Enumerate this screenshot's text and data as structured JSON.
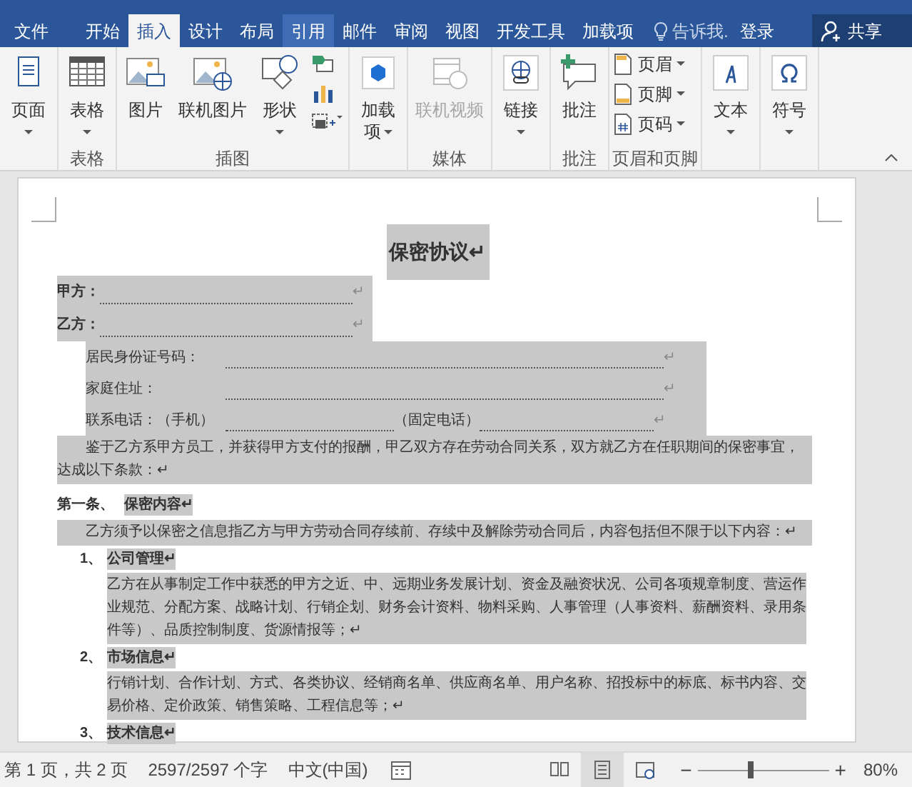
{
  "menu_tabs": [
    {
      "label": "文件",
      "selected": false,
      "hover": false
    },
    {
      "label": "开始",
      "selected": false,
      "hover": false
    },
    {
      "label": "插入",
      "selected": true,
      "hover": false
    },
    {
      "label": "设计",
      "selected": false,
      "hover": false
    },
    {
      "label": "布局",
      "selected": false,
      "hover": false
    },
    {
      "label": "引用",
      "selected": false,
      "hover": true
    },
    {
      "label": "邮件",
      "selected": false,
      "hover": false
    },
    {
      "label": "审阅",
      "selected": false,
      "hover": false
    },
    {
      "label": "视图",
      "selected": false,
      "hover": false
    },
    {
      "label": "开发工具",
      "selected": false,
      "hover": false
    },
    {
      "label": "加载项",
      "selected": false,
      "hover": false
    }
  ],
  "tell_me": "告诉我.",
  "login": "登录",
  "share": "共享",
  "ribbon_groups": [
    {
      "buttons": [
        {
          "kind": "large",
          "label": "页面",
          "dropdown": true,
          "disabled": false
        }
      ]
    },
    {
      "label": "表格",
      "buttons": [
        {
          "kind": "large",
          "label": "表格",
          "dropdown": true,
          "disabled": false
        }
      ]
    },
    {
      "label": "插图",
      "buttons": [
        {
          "kind": "large",
          "label": "图片",
          "dropdown": false,
          "disabled": false
        },
        {
          "kind": "large",
          "label": "联机图片",
          "dropdown": false,
          "disabled": false
        },
        {
          "kind": "large",
          "label": "形状",
          "dropdown": true,
          "disabled": false
        },
        {
          "kind": "icons"
        }
      ]
    },
    {
      "buttons": [
        {
          "kind": "large",
          "label": "加载",
          "label2": "项",
          "dropdown": true,
          "disabled": false
        }
      ]
    },
    {
      "label": "媒体",
      "buttons": [
        {
          "kind": "large",
          "label": "联机视频",
          "dropdown": false,
          "disabled": true
        }
      ]
    },
    {
      "buttons": [
        {
          "kind": "large",
          "label": "链接",
          "dropdown": true,
          "disabled": false
        }
      ]
    },
    {
      "label": "批注",
      "buttons": [
        {
          "kind": "large",
          "label": "批注",
          "dropdown": false,
          "disabled": false
        }
      ]
    },
    {
      "label": "页眉和页脚",
      "buttons": [
        {
          "kind": "small",
          "label": "页眉",
          "dropdown": true,
          "disabled": false
        },
        {
          "kind": "small",
          "label": "页脚",
          "dropdown": true,
          "disabled": false
        },
        {
          "kind": "small",
          "label": "页码",
          "dropdown": true,
          "disabled": false
        }
      ]
    },
    {
      "buttons": [
        {
          "kind": "large",
          "label": "文本",
          "dropdown": true,
          "disabled": false
        }
      ]
    },
    {
      "buttons": [
        {
          "kind": "large",
          "label": "符号",
          "dropdown": true,
          "disabled": false
        }
      ]
    }
  ],
  "document": [
    {
      "kind": "title",
      "text": "保密协议↵",
      "highlighted": true
    },
    {
      "kind": "party",
      "label": "甲方：",
      "end": "↵",
      "highlighted": true
    },
    {
      "kind": "party",
      "label": "乙方：",
      "end": "↵",
      "highlighted": true
    },
    {
      "kind": "field",
      "label": "居民身份证号码：",
      "end": "↵",
      "highlighted": true
    },
    {
      "kind": "field",
      "label": "家庭住址：",
      "end": "↵",
      "highlighted": true
    },
    {
      "kind": "phone",
      "label": "联系电话：（手机）",
      "label2": "（固定电话）",
      "end": "↵",
      "highlighted": true
    },
    {
      "kind": "body",
      "text": "鉴于乙方系甲方员工，并获得甲方支付的报酬，甲乙双方存在劳动合同关系，双方就乙方在任职期间的保密事宜，达成以下条款：↵",
      "highlighted": true
    },
    {
      "kind": "article",
      "number": "第一条、",
      "text": "保密内容↵",
      "highlighted": true
    },
    {
      "kind": "body",
      "text": "乙方须予以保密之信息指乙方与甲方劳动合同存续前、存续中及解除劳动合同后，内容包括但不限于以下内容：↵",
      "highlighted": true
    },
    {
      "kind": "item",
      "number": "1、",
      "text": "公司管理↵",
      "highlighted": true
    },
    {
      "kind": "subbody",
      "text": "乙方在从事制定工作中获悉的甲方之近、中、远期业务发展计划、资金及融资状况、公司各项规章制度、营运作业规范、分配方案、战略计划、行销企划、财务会计资料、物料采购、人事管理（人事资料、薪酬资料、录用条件等）、品质控制制度、货源情报等；↵",
      "highlighted": true
    },
    {
      "kind": "item",
      "number": "2、",
      "text": "市场信息↵",
      "highlighted": true
    },
    {
      "kind": "subbody",
      "text": "行销计划、合作计划、方式、各类协议、经销商名单、供应商名单、用户名称、招投标中的标底、标书内容、交易价格、定价政策、销售策略、工程信息等；↵",
      "highlighted": true
    },
    {
      "kind": "item",
      "number": "3、",
      "text": "技术信息↵",
      "highlighted": true
    }
  ],
  "status_bar": {
    "pages": "第 1 页，共 2 页",
    "words": "2597/2597 个字",
    "language": "中文(中国)",
    "views": [
      {
        "kind": "read",
        "selected": false
      },
      {
        "kind": "print",
        "selected": true
      },
      {
        "kind": "web",
        "selected": false
      }
    ],
    "zoom": {
      "level": 0.4,
      "minus": "−",
      "plus": "+",
      "reading": "80%"
    }
  }
}
